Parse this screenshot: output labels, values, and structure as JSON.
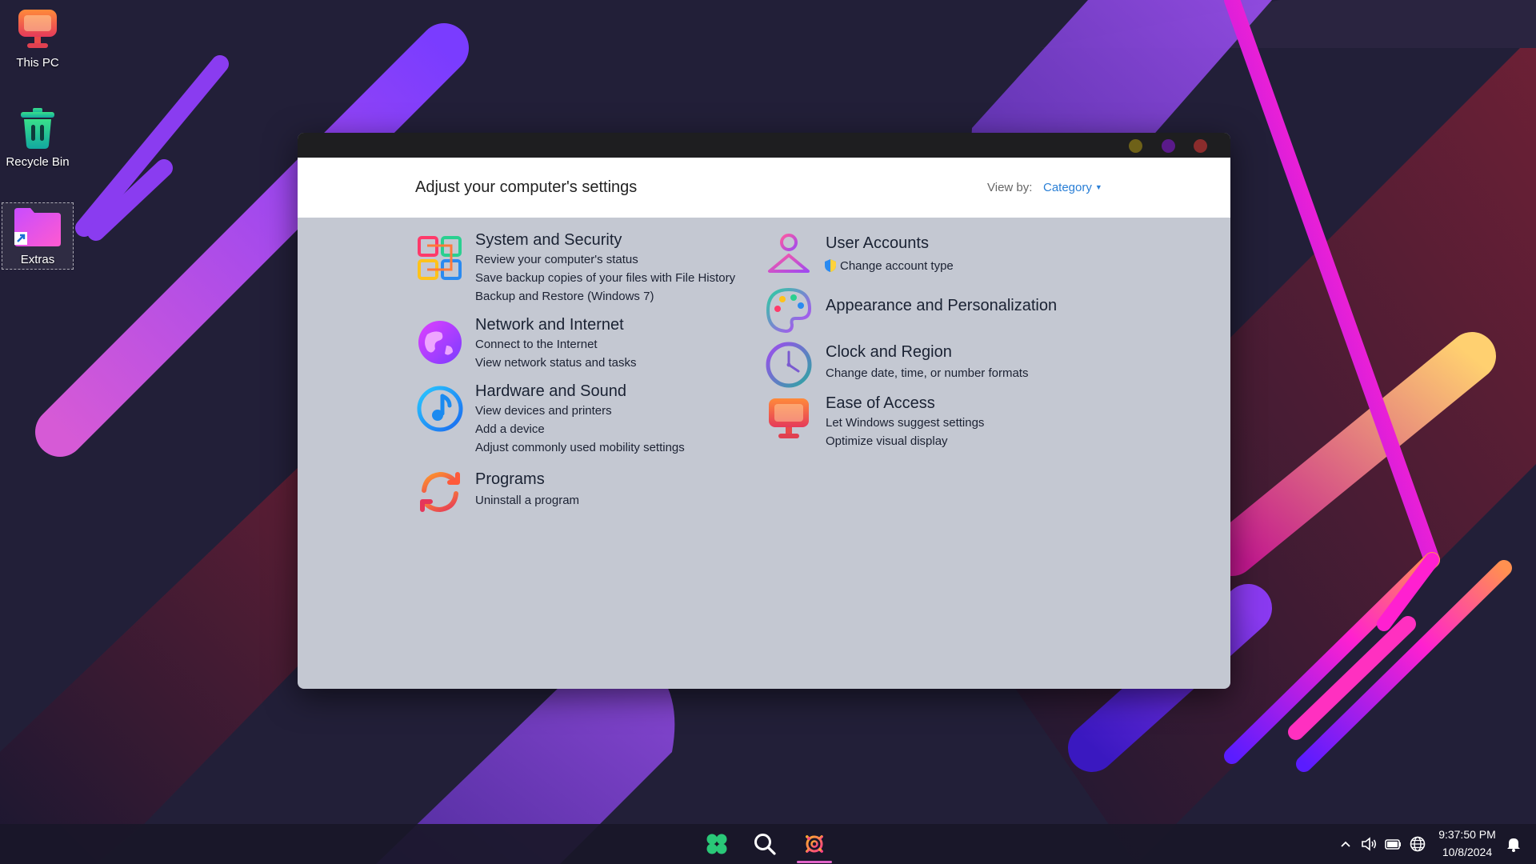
{
  "desktop": {
    "icons": [
      {
        "label": "This PC",
        "icon": "monitor-icon"
      },
      {
        "label": "Recycle Bin",
        "icon": "recycle-bin-icon"
      },
      {
        "label": "Extras",
        "icon": "folder-shortcut-icon"
      }
    ]
  },
  "window": {
    "controls": [
      "minimize",
      "maximize",
      "close"
    ],
    "control_colors": [
      "#6e6118",
      "#5a1a8a",
      "#8b2c2c"
    ],
    "header": {
      "title": "Adjust your computer's settings",
      "view_by_label": "View by:",
      "view_by_value": "Category"
    },
    "left_categories": [
      {
        "title": "System and Security",
        "icon": "system-security-icon",
        "links": [
          "Review your computer's status",
          "Save backup copies of your files with File History",
          "Backup and Restore (Windows 7)"
        ]
      },
      {
        "title": "Network and Internet",
        "icon": "globe-icon",
        "links": [
          "Connect to the Internet",
          "View network status and tasks"
        ]
      },
      {
        "title": "Hardware and Sound",
        "icon": "music-note-icon",
        "links": [
          "View devices and printers",
          "Add a device",
          "Adjust commonly used mobility settings"
        ]
      },
      {
        "title": "Programs",
        "icon": "refresh-icon",
        "links": [
          "Uninstall a program"
        ]
      }
    ],
    "right_categories": [
      {
        "title": "User Accounts",
        "icon": "user-icon",
        "links": [
          "Change account type"
        ]
      },
      {
        "title": "Appearance and Personalization",
        "icon": "palette-icon",
        "links": []
      },
      {
        "title": "Clock and Region",
        "icon": "clock-icon",
        "links": [
          "Change date, time, or number formats"
        ]
      },
      {
        "title": "Ease of Access",
        "icon": "monitor-icon",
        "links": [
          "Let Windows suggest settings",
          "Optimize visual display"
        ]
      }
    ]
  },
  "taskbar": {
    "pinned": [
      {
        "name": "start",
        "icon": "clover-icon"
      },
      {
        "name": "search",
        "icon": "search-icon"
      },
      {
        "name": "settings",
        "icon": "gear-icon",
        "active": true
      }
    ],
    "tray": [
      "chevron-up-icon",
      "speaker-icon",
      "battery-icon",
      "globe-icon"
    ],
    "time": "9:37:50 PM",
    "date": "10/8/2024",
    "notification_icon": "bell-icon"
  },
  "colors": {
    "link": "#2a7fd6",
    "window_body": "#c4c8d2",
    "desktop_bg": "#221f38"
  }
}
